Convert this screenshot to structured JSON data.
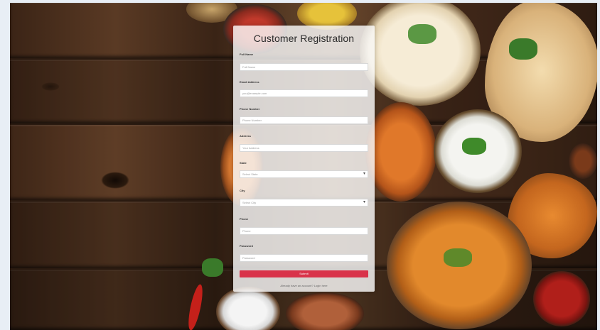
{
  "form": {
    "title": "Customer Registration",
    "fields": [
      {
        "label": "Full Name",
        "placeholder": "Full Name",
        "type": "text"
      },
      {
        "label": "Email Address",
        "placeholder": "you@example.com",
        "type": "email"
      },
      {
        "label": "Phone Number",
        "placeholder": "Phone Number",
        "type": "text"
      },
      {
        "label": "Address",
        "placeholder": "Your Address",
        "type": "text"
      },
      {
        "label": "State",
        "placeholder": "Select State",
        "type": "select"
      },
      {
        "label": "City",
        "placeholder": "Select City",
        "type": "select"
      },
      {
        "label": "Phone",
        "placeholder": "Phone",
        "type": "text"
      },
      {
        "label": "Password",
        "placeholder": "Password",
        "type": "password"
      }
    ],
    "submit_label": "Submit",
    "footer_text": "Already have an account? Login here"
  },
  "colors": {
    "submit": "#d9334a",
    "card": "#fafafa",
    "page_bg": "#e8eef5"
  }
}
